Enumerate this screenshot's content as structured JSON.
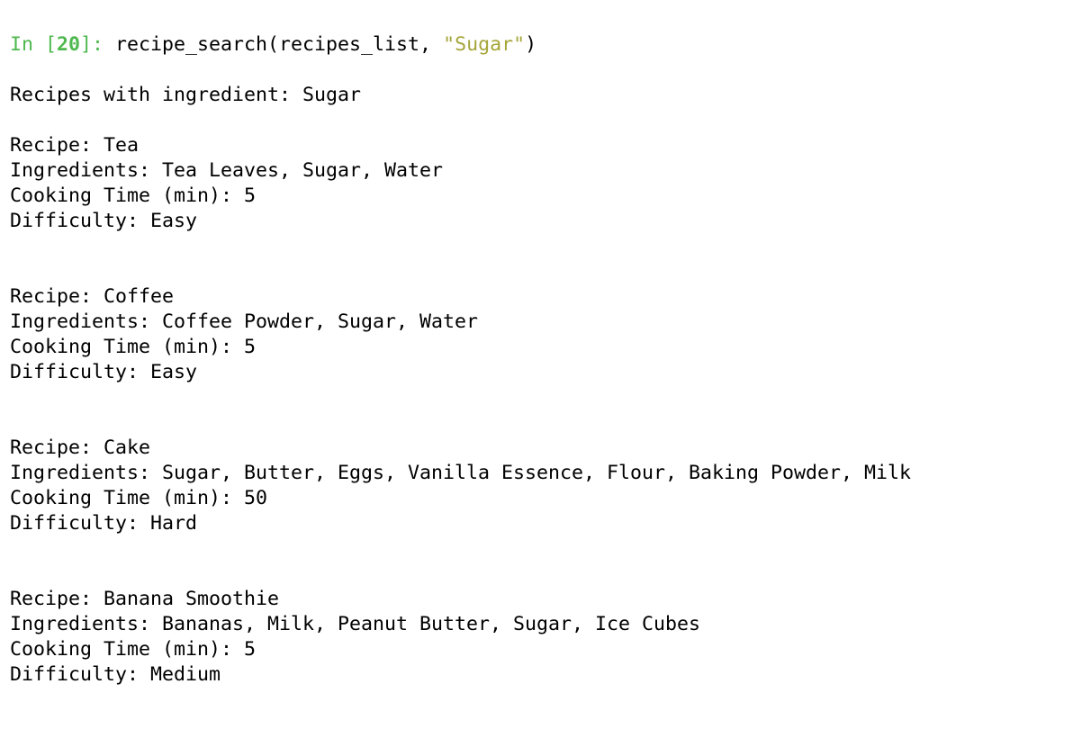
{
  "input_cell": {
    "prompt_prefix": "In [",
    "execution_count": "20",
    "prompt_suffix": "]: ",
    "code_call": "recipe_search(recipes_list, ",
    "code_arg": "\"Sugar\"",
    "code_close": ")"
  },
  "output": {
    "header": "Recipes with ingredient: Sugar",
    "recipes": [
      {
        "name_line": "Recipe: Tea",
        "ingredients_line": "Ingredients: Tea Leaves, Sugar, Water",
        "time_line": "Cooking Time (min): 5",
        "difficulty_line": "Difficulty: Easy"
      },
      {
        "name_line": "Recipe: Coffee",
        "ingredients_line": "Ingredients: Coffee Powder, Sugar, Water",
        "time_line": "Cooking Time (min): 5",
        "difficulty_line": "Difficulty: Easy"
      },
      {
        "name_line": "Recipe: Cake",
        "ingredients_line": "Ingredients: Sugar, Butter, Eggs, Vanilla Essence, Flour, Baking Powder, Milk",
        "time_line": "Cooking Time (min): 50",
        "difficulty_line": "Difficulty: Hard"
      },
      {
        "name_line": "Recipe: Banana Smoothie",
        "ingredients_line": "Ingredients: Bananas, Milk, Peanut Butter, Sugar, Ice Cubes",
        "time_line": "Cooking Time (min): 5",
        "difficulty_line": "Difficulty: Medium"
      }
    ]
  },
  "colors": {
    "prompt": "#4fb94f",
    "string": "#a5a53a",
    "text": "#000000",
    "background": "#ffffff"
  }
}
